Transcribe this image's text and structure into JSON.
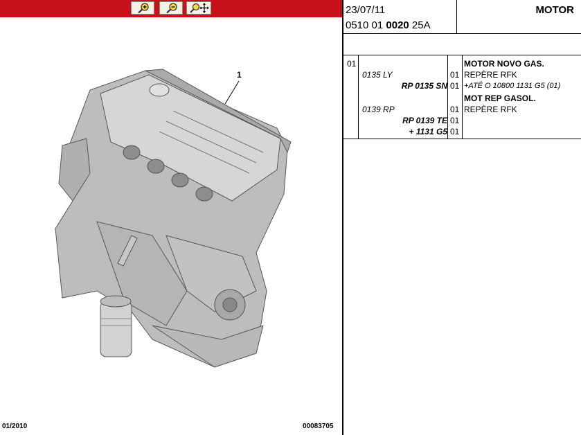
{
  "toolbar": {
    "zoom_in_icon": "zoom-in-icon",
    "zoom_out_icon": "zoom-out-icon",
    "zoom_pan_icon": "zoom-pan-icon"
  },
  "drawing": {
    "callout": "1",
    "footer_date": "01/2010",
    "footer_ref": "00083705"
  },
  "header": {
    "date": "23/07/11",
    "code_prefix": "0510 01 ",
    "code_bold": "0020",
    "code_suffix": " 25A",
    "title": "MOTOR"
  },
  "parts": {
    "item": "01",
    "rows": [
      {
        "ref": "",
        "qty": "",
        "desc": "MOTOR NOVO GAS."
      },
      {
        "ref": "0135 LY",
        "qty": "01",
        "desc": "REPÈRE RFK"
      },
      {
        "ref": "RP 0135 SN",
        "qty": "01",
        "desc": "+ATÉ O 10800 1131 G5 (01)"
      },
      {
        "ref": "",
        "qty": "",
        "desc": "MOT REP GASOL."
      },
      {
        "ref": "0139 RP",
        "qty": "01",
        "desc": "REPÈRE RFK"
      },
      {
        "ref": "RP 0139 TE",
        "qty": "01",
        "desc": ""
      },
      {
        "ref": "+ 1131 G5",
        "qty": "01",
        "desc": ""
      }
    ]
  }
}
